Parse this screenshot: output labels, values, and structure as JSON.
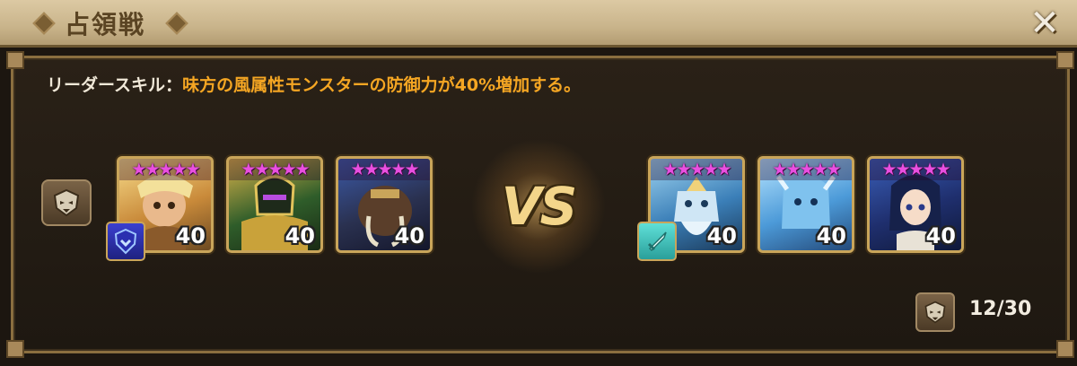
{
  "header": {
    "title": "占領戦",
    "close_icon": "close-x-icon"
  },
  "leader_skill": {
    "label": "リーダースキル：",
    "text": "味方の風属性モンスターの防御力が40%増加する。"
  },
  "colors": {
    "accent_text": "#f5a623",
    "star_color": "#e94fe0",
    "frame_border": "#8a6e3f"
  },
  "left_team": {
    "monsters": [
      {
        "icon": "monster-portrait-gold-horned",
        "stars": "★★★★★",
        "level": "40"
      },
      {
        "icon": "monster-portrait-dark-knight",
        "stars": "★★★★★",
        "level": "40"
      },
      {
        "icon": "monster-portrait-mammoth",
        "stars": "★★★★★",
        "level": "40"
      }
    ],
    "leader_badge_icon": "shield-badge-icon"
  },
  "versus": "VS",
  "right_team": {
    "monsters": [
      {
        "icon": "monster-portrait-ice-golem",
        "stars": "★★★★★",
        "level": "40"
      },
      {
        "icon": "monster-portrait-ice-yeti",
        "stars": "★★★★★",
        "level": "40"
      },
      {
        "icon": "monster-portrait-warrior-girl",
        "stars": "★★★★★",
        "level": "40"
      }
    ],
    "leader_badge_icon": "sword-badge-icon"
  },
  "side_button_icon": "monster-mask-icon",
  "counter": {
    "icon": "monster-mask-icon",
    "text": "12/30"
  }
}
